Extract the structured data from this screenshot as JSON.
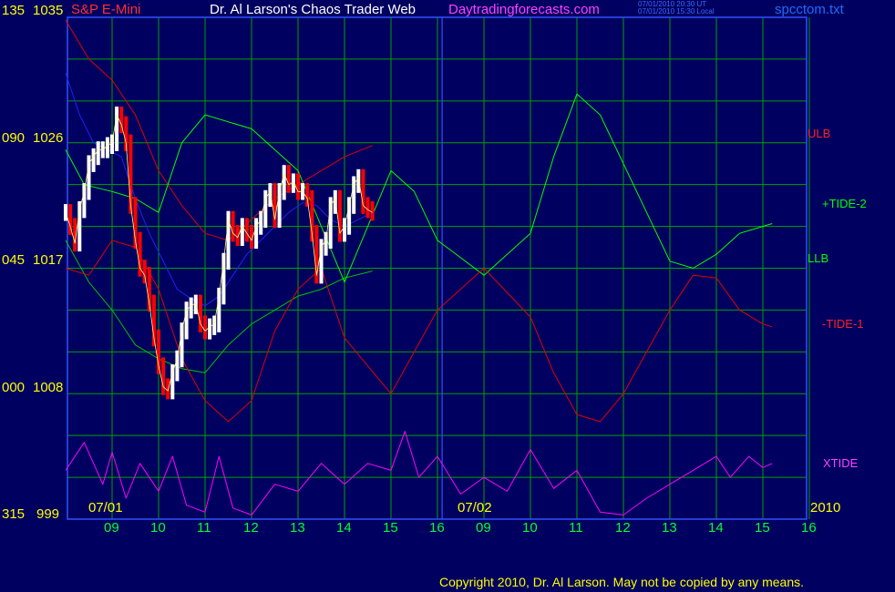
{
  "header": {
    "symbol": "S&P E-Mini",
    "title": "Dr. Al Larson's Chaos Trader Web",
    "website": "Daytradingforecasts.com",
    "timestamp_ut": "07/01/2010 20:30 UT",
    "timestamp_local": "07/01/2010 15:30 Local",
    "filename": "spcctom.txt"
  },
  "y_axis": {
    "labels": [
      {
        "left": "135",
        "right": "1035"
      },
      {
        "left": "090",
        "right": "1026"
      },
      {
        "left": "045",
        "right": "1017"
      },
      {
        "left": "000",
        "right": "1008"
      },
      {
        "left": "315",
        "right": "999"
      }
    ]
  },
  "legend": {
    "ulb": "ULB",
    "tide2": "+TIDE-2",
    "llb": "LLB",
    "tide1": "-TIDE-1",
    "xtide": "XTIDE"
  },
  "x_axis": {
    "dates": [
      "07/01",
      "07/02"
    ],
    "year": "2010",
    "hours": [
      "09",
      "10",
      "11",
      "12",
      "13",
      "14",
      "15",
      "16",
      "09",
      "10",
      "11",
      "12",
      "13",
      "14",
      "15",
      "16"
    ]
  },
  "copyright": "Copyright 2010, Dr. Al Larson. May not be copied by any means.",
  "colors": {
    "background": "#000060",
    "grid": "#00a000",
    "price_down": "#ff0000",
    "price_up": "#ffffff",
    "ulb": "#e00000",
    "llb": "#00c000",
    "tide2": "#00ff00",
    "tide1": "#e00000",
    "xtide": "#ff00ff",
    "ma": "#2020ff",
    "axis_text": "#ffff00",
    "hour_text": "#00ff30"
  },
  "chart_data": {
    "type": "line",
    "symbol": "S&P E-Mini",
    "ylim": [
      999,
      1035
    ],
    "price_series": {
      "name": "S&P E-Mini price",
      "points": [
        [
          0.0,
          1021.0
        ],
        [
          0.1,
          1020.0
        ],
        [
          0.2,
          1018.8
        ],
        [
          0.3,
          1021.2
        ],
        [
          0.4,
          1022.5
        ],
        [
          0.5,
          1024.5
        ],
        [
          0.6,
          1025.0
        ],
        [
          0.7,
          1025.5
        ],
        [
          0.8,
          1025.5
        ],
        [
          0.9,
          1025.8
        ],
        [
          1.0,
          1026.0
        ],
        [
          1.1,
          1028.0
        ],
        [
          1.2,
          1027.3
        ],
        [
          1.3,
          1026.0
        ],
        [
          1.4,
          1021.5
        ],
        [
          1.5,
          1019.0
        ],
        [
          1.6,
          1017.0
        ],
        [
          1.7,
          1016.5
        ],
        [
          1.8,
          1014.5
        ],
        [
          1.9,
          1012.0
        ],
        [
          2.0,
          1010.0
        ],
        [
          2.1,
          1008.5
        ],
        [
          2.2,
          1008.2
        ],
        [
          2.3,
          1009.5
        ],
        [
          2.4,
          1010.5
        ],
        [
          2.5,
          1012.5
        ],
        [
          2.6,
          1014.0
        ],
        [
          2.7,
          1014.3
        ],
        [
          2.8,
          1014.5
        ],
        [
          2.9,
          1013.0
        ],
        [
          3.0,
          1012.5
        ],
        [
          3.1,
          1012.8
        ],
        [
          3.2,
          1013.0
        ],
        [
          3.3,
          1015.0
        ],
        [
          3.4,
          1017.5
        ],
        [
          3.5,
          1020.5
        ],
        [
          3.6,
          1019.5
        ],
        [
          3.7,
          1019.2
        ],
        [
          3.8,
          1020.0
        ],
        [
          3.9,
          1019.5
        ],
        [
          4.0,
          1019.0
        ],
        [
          4.1,
          1020.0
        ],
        [
          4.2,
          1020.5
        ],
        [
          4.3,
          1022.0
        ],
        [
          4.4,
          1022.5
        ],
        [
          4.5,
          1020.5
        ],
        [
          4.6,
          1022.5
        ],
        [
          4.7,
          1023.8
        ],
        [
          4.8,
          1023.0
        ],
        [
          4.9,
          1023.2
        ],
        [
          5.0,
          1022.5
        ],
        [
          5.1,
          1022.5
        ],
        [
          5.2,
          1022.0
        ],
        [
          5.3,
          1019.5
        ],
        [
          5.4,
          1016.5
        ],
        [
          5.5,
          1018.5
        ],
        [
          5.6,
          1019.0
        ],
        [
          5.7,
          1021.5
        ],
        [
          5.8,
          1022.0
        ],
        [
          5.9,
          1019.5
        ],
        [
          6.0,
          1020.0
        ],
        [
          6.1,
          1021.5
        ],
        [
          6.2,
          1023.0
        ],
        [
          6.3,
          1023.5
        ],
        [
          6.4,
          1021.5
        ],
        [
          6.5,
          1021.2
        ],
        [
          6.6,
          1021.0
        ]
      ]
    },
    "ma_series": {
      "name": "moving average",
      "points": [
        [
          0.0,
          1031.0
        ],
        [
          0.3,
          1028.0
        ],
        [
          0.6,
          1026.0
        ],
        [
          0.9,
          1025.5
        ],
        [
          1.2,
          1025.0
        ],
        [
          1.5,
          1022.0
        ],
        [
          1.8,
          1019.5
        ],
        [
          2.1,
          1017.5
        ],
        [
          2.4,
          1015.5
        ],
        [
          2.7,
          1014.8
        ],
        [
          3.0,
          1014.3
        ],
        [
          3.3,
          1015.0
        ],
        [
          3.6,
          1016.5
        ],
        [
          3.9,
          1018.0
        ],
        [
          4.2,
          1019.0
        ],
        [
          4.5,
          1020.0
        ],
        [
          4.8,
          1021.0
        ],
        [
          5.1,
          1021.7
        ],
        [
          5.4,
          1021.5
        ],
        [
          5.7,
          1020.5
        ],
        [
          6.0,
          1020.0
        ],
        [
          6.3,
          1020.5
        ],
        [
          6.6,
          1021.0
        ]
      ]
    },
    "series": [
      {
        "name": "ULB",
        "points": [
          [
            0.0,
            1034.8
          ],
          [
            0.5,
            1032.0
          ],
          [
            1.0,
            1030.5
          ],
          [
            1.5,
            1028.0
          ],
          [
            2.0,
            1024.0
          ],
          [
            2.5,
            1021.5
          ],
          [
            3.0,
            1019.5
          ],
          [
            3.5,
            1019.0
          ],
          [
            4.0,
            1020.5
          ],
          [
            4.5,
            1022.0
          ],
          [
            5.0,
            1023.0
          ],
          [
            5.5,
            1024.0
          ],
          [
            6.0,
            1025.0
          ],
          [
            6.6,
            1025.8
          ]
        ]
      },
      {
        "name": "LLB",
        "points": [
          [
            0.0,
            1019.0
          ],
          [
            0.5,
            1016.0
          ],
          [
            1.0,
            1014.0
          ],
          [
            1.5,
            1011.5
          ],
          [
            2.0,
            1010.5
          ],
          [
            2.5,
            1009.8
          ],
          [
            3.0,
            1009.5
          ],
          [
            3.5,
            1011.5
          ],
          [
            4.0,
            1013.0
          ],
          [
            4.5,
            1014.0
          ],
          [
            5.0,
            1015.0
          ],
          [
            5.5,
            1015.5
          ],
          [
            6.0,
            1016.3
          ],
          [
            6.6,
            1016.8
          ]
        ]
      },
      {
        "name": "+TIDE-2",
        "points": [
          [
            0.0,
            1025.5
          ],
          [
            0.4,
            1023.0
          ],
          [
            1.0,
            1022.5
          ],
          [
            1.5,
            1022.0
          ],
          [
            2.0,
            1021.0
          ],
          [
            2.5,
            1026.0
          ],
          [
            3.0,
            1028.0
          ],
          [
            4.0,
            1027.0
          ],
          [
            5.0,
            1024.0
          ],
          [
            6.0,
            1016.0
          ],
          [
            7.0,
            1024.0
          ],
          [
            7.5,
            1022.5
          ],
          [
            8.0,
            1019.0
          ],
          [
            9.0,
            1016.5
          ],
          [
            10.0,
            1019.5
          ],
          [
            10.5,
            1025.0
          ],
          [
            11.0,
            1029.5
          ],
          [
            11.5,
            1028.0
          ],
          [
            12.0,
            1024.5
          ],
          [
            13.0,
            1017.5
          ],
          [
            13.5,
            1017.0
          ],
          [
            14.0,
            1018.0
          ],
          [
            14.5,
            1019.5
          ],
          [
            15.0,
            1020.0
          ],
          [
            15.2,
            1020.2
          ]
        ]
      },
      {
        "name": "-TIDE-1",
        "points": [
          [
            0.0,
            1017.0
          ],
          [
            0.5,
            1016.5
          ],
          [
            1.0,
            1019.0
          ],
          [
            1.5,
            1018.5
          ],
          [
            2.0,
            1015.5
          ],
          [
            2.5,
            1010.5
          ],
          [
            3.0,
            1007.5
          ],
          [
            3.5,
            1006.0
          ],
          [
            4.0,
            1007.5
          ],
          [
            4.5,
            1012.5
          ],
          [
            5.0,
            1015.5
          ],
          [
            5.5,
            1017.0
          ],
          [
            6.0,
            1012.0
          ],
          [
            7.0,
            1008.0
          ],
          [
            7.5,
            1011.0
          ],
          [
            8.0,
            1014.0
          ],
          [
            9.0,
            1017.0
          ],
          [
            10.0,
            1013.5
          ],
          [
            10.5,
            1009.5
          ],
          [
            11.0,
            1006.5
          ],
          [
            11.5,
            1006.0
          ],
          [
            12.0,
            1008.0
          ],
          [
            13.0,
            1014.0
          ],
          [
            13.5,
            1016.5
          ],
          [
            14.0,
            1016.3
          ],
          [
            14.5,
            1014.0
          ],
          [
            15.0,
            1013.0
          ],
          [
            15.2,
            1012.8
          ]
        ]
      },
      {
        "name": "XTIDE",
        "points": [
          [
            0.0,
            1002.5
          ],
          [
            0.4,
            1004.5
          ],
          [
            0.8,
            1001.5
          ],
          [
            1.0,
            1003.8
          ],
          [
            1.3,
            1000.5
          ],
          [
            1.6,
            1003.0
          ],
          [
            2.0,
            1001.0
          ],
          [
            2.3,
            1003.5
          ],
          [
            2.6,
            1000.0
          ],
          [
            3.0,
            999.5
          ],
          [
            3.3,
            1003.5
          ],
          [
            3.6,
            999.8
          ],
          [
            4.0,
            999.3
          ],
          [
            4.5,
            1001.5
          ],
          [
            5.0,
            1001.0
          ],
          [
            5.5,
            1003.0
          ],
          [
            6.0,
            1001.5
          ],
          [
            6.5,
            1003.0
          ],
          [
            7.0,
            1002.5
          ],
          [
            7.3,
            1005.3
          ],
          [
            7.6,
            1002.0
          ],
          [
            8.0,
            1003.5
          ],
          [
            8.5,
            1000.8
          ],
          [
            9.0,
            1002.0
          ],
          [
            9.5,
            1001.0
          ],
          [
            10.0,
            1004.0
          ],
          [
            10.5,
            1001.2
          ],
          [
            11.0,
            1002.5
          ],
          [
            11.5,
            999.5
          ],
          [
            12.0,
            999.3
          ],
          [
            12.5,
            1000.5
          ],
          [
            13.0,
            1001.5
          ],
          [
            13.5,
            1002.5
          ],
          [
            14.0,
            1003.5
          ],
          [
            14.3,
            1002.0
          ],
          [
            14.7,
            1003.5
          ],
          [
            15.0,
            1002.7
          ],
          [
            15.2,
            1003.0
          ]
        ]
      }
    ]
  }
}
